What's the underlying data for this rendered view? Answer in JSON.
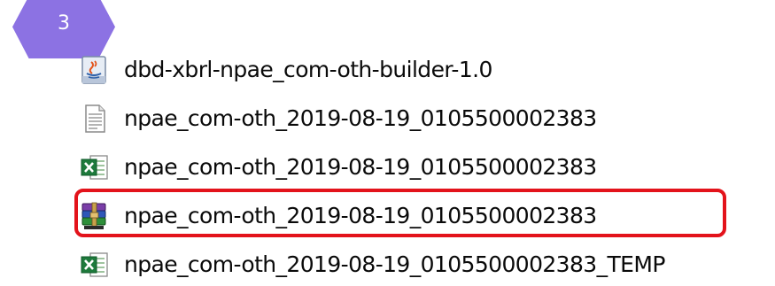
{
  "step_badge": {
    "label": "3"
  },
  "files": [
    {
      "name": "dbd-xbrl-npae_com-oth-builder-1.0",
      "icon": "java-jar-icon"
    },
    {
      "name": "npae_com-oth_2019-08-19_0105500002383",
      "icon": "text-file-icon"
    },
    {
      "name": "npae_com-oth_2019-08-19_0105500002383",
      "icon": "excel-file-icon"
    },
    {
      "name": "npae_com-oth_2019-08-19_0105500002383",
      "icon": "winrar-archive-icon"
    },
    {
      "name": "npae_com-oth_2019-08-19_0105500002383_TEMP",
      "icon": "excel-file-icon"
    }
  ],
  "highlight": {
    "color": "#e3131b",
    "target_index": 3
  },
  "colors": {
    "badge": "#8c72e3",
    "text": "#0a0a0a",
    "background": "#ffffff"
  }
}
